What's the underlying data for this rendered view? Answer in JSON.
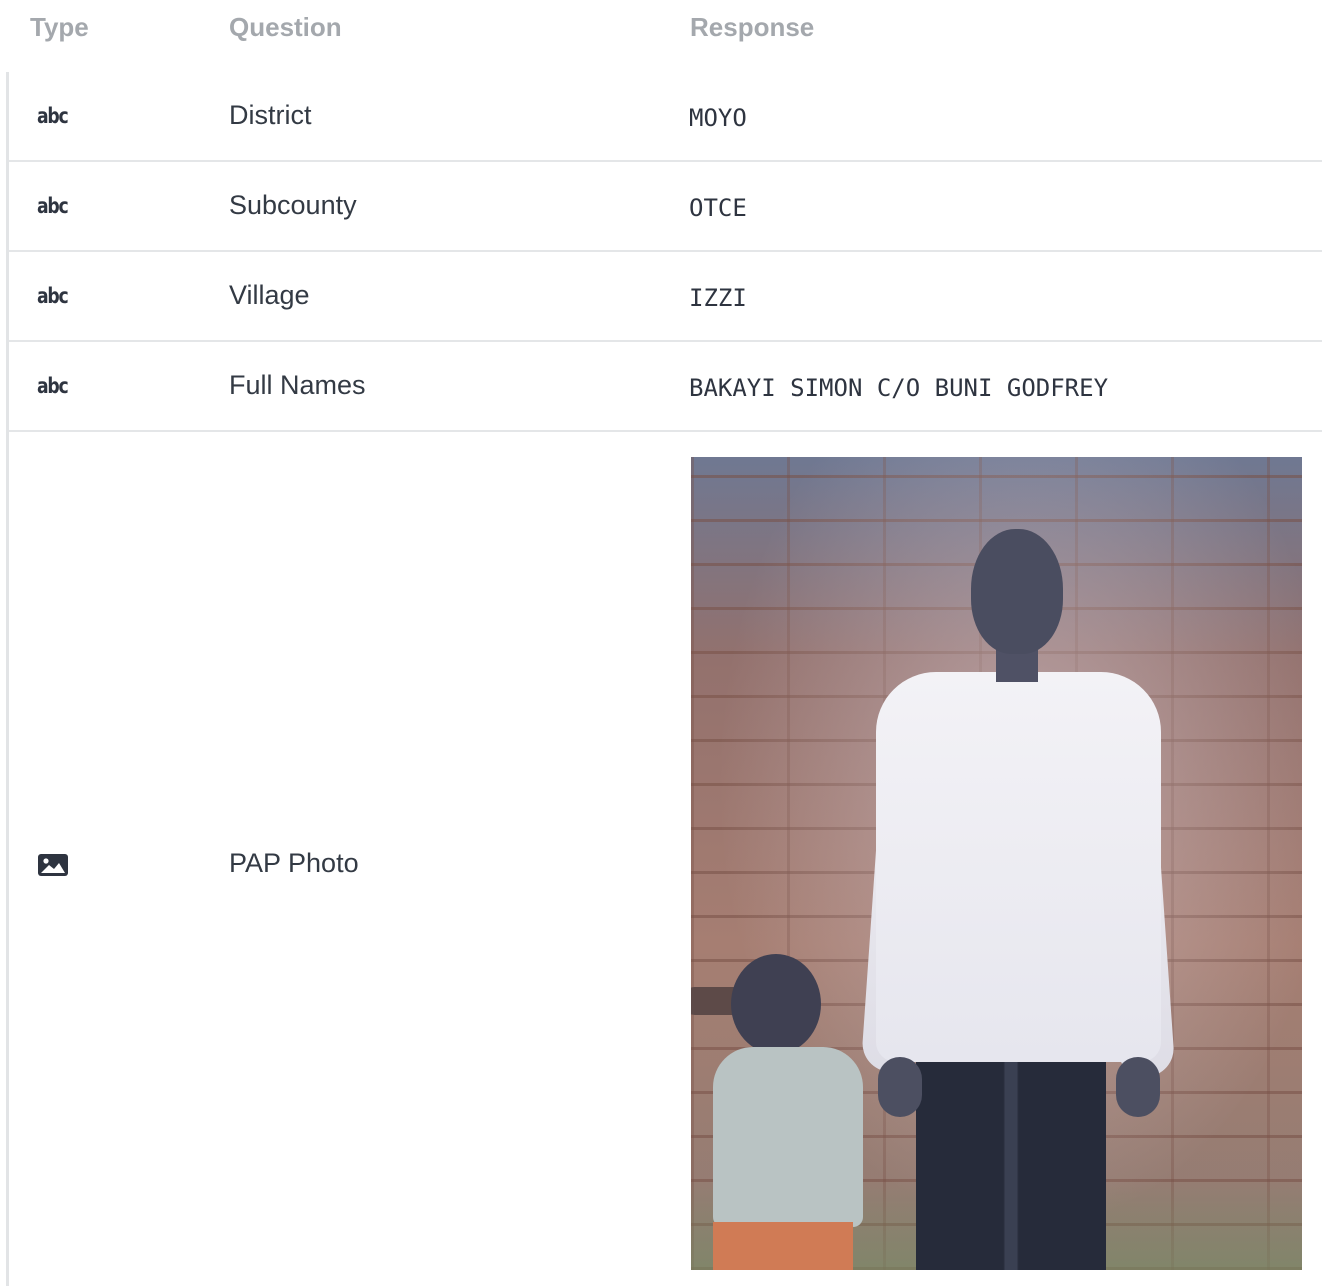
{
  "header": {
    "type": "Type",
    "question": "Question",
    "response": "Response"
  },
  "rows": [
    {
      "type_label": "abc",
      "question": "District",
      "response": "MOYO"
    },
    {
      "type_label": "abc",
      "question": "Subcounty",
      "response": "OTCE"
    },
    {
      "type_label": "abc",
      "question": "Village",
      "response": "IZZI"
    },
    {
      "type_label": "abc",
      "question": "Full Names",
      "response": "BAKAYI SIMON C/O BUNI GODFREY"
    }
  ],
  "photo_row": {
    "type_icon": "image-icon",
    "question": "PAP Photo"
  },
  "colors": {
    "header_text": "#a4a8ad",
    "body_text": "#333a44",
    "divider": "#e4e6e8"
  }
}
